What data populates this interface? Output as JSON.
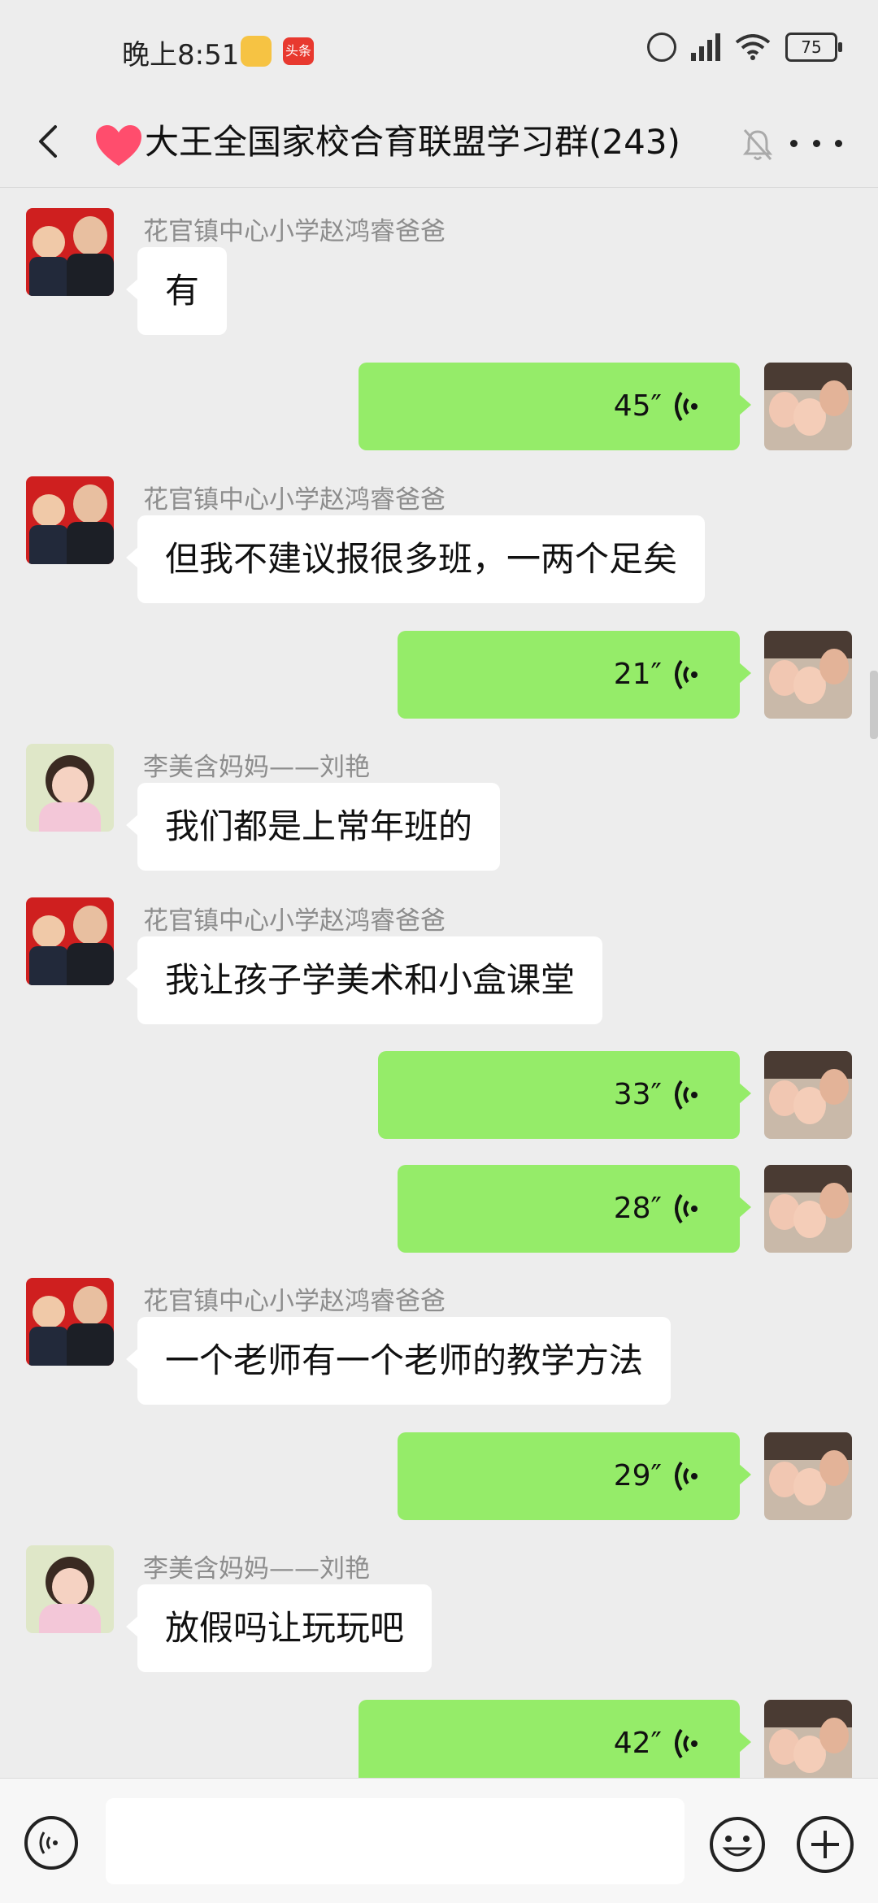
{
  "status_bar": {
    "time": "晚上8:51",
    "app_badge": "头条",
    "battery": "75"
  },
  "header": {
    "title": "大王全国家校合育联盟学习群(243)",
    "accent_color": "#ff4d6d"
  },
  "messages": [
    {
      "type": "text",
      "sender": "花官镇中心小学赵鸿睿爸爸",
      "text": "有"
    },
    {
      "type": "voice",
      "duration": "45″"
    },
    {
      "type": "text",
      "sender": "花官镇中心小学赵鸿睿爸爸",
      "text": "但我不建议报很多班，一两个足矣"
    },
    {
      "type": "voice",
      "duration": "21″"
    },
    {
      "type": "text",
      "sender": "李美含妈妈——刘艳",
      "text": "我们都是上常年班的"
    },
    {
      "type": "text",
      "sender": "花官镇中心小学赵鸿睿爸爸",
      "text": "我让孩子学美术和小盒课堂"
    },
    {
      "type": "voice",
      "duration": "33″"
    },
    {
      "type": "voice",
      "duration": "28″"
    },
    {
      "type": "text",
      "sender": "花官镇中心小学赵鸿睿爸爸",
      "text": "一个老师有一个老师的教学方法"
    },
    {
      "type": "voice",
      "duration": "29″"
    },
    {
      "type": "text",
      "sender": "李美含妈妈——刘艳",
      "text": "放假吗让玩玩吧"
    },
    {
      "type": "voice",
      "duration": "42″"
    }
  ],
  "input_bar": {
    "placeholder": ""
  },
  "colors": {
    "voice_bubble": "#95ec69",
    "background": "#ededed"
  }
}
